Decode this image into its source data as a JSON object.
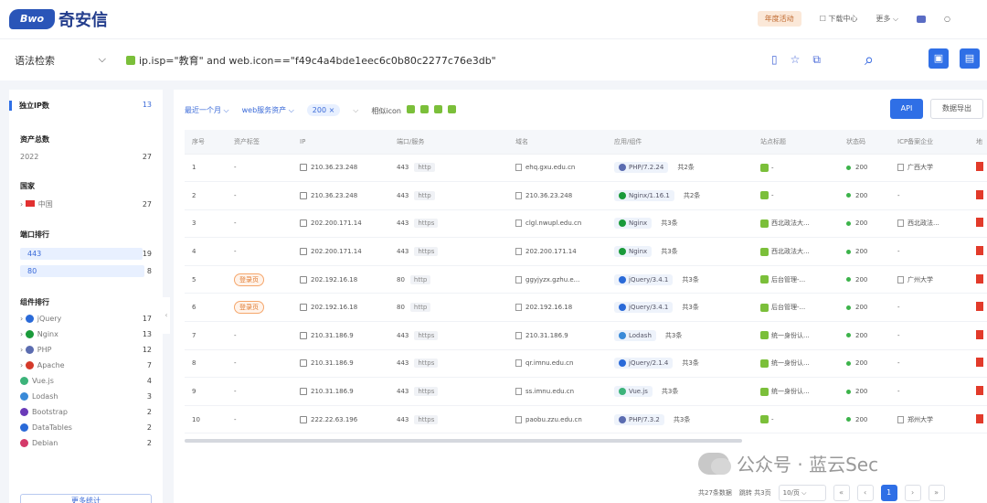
{
  "header": {
    "logo_mark": "Bwo",
    "logo_text": "奇安信",
    "promo": "年度活动",
    "download": "下载中心",
    "more": "更多"
  },
  "search": {
    "type": "语法检索",
    "query": "ip.isp=\"教育\" and web.icon==\"f49c4a4bde1eec6c0b80c2277c76e3db\""
  },
  "sidebar": {
    "unique_ip": {
      "label": "独立IP数",
      "count": "13"
    },
    "asset_total": {
      "label": "资产总数",
      "year": "2022",
      "count": "27"
    },
    "country": {
      "label": "国家",
      "name": "中国",
      "count": "27"
    },
    "ports": {
      "label": "端口排行",
      "items": [
        {
          "port": "443",
          "count": "19"
        },
        {
          "port": "80",
          "count": "8"
        }
      ]
    },
    "components": {
      "label": "组件排行",
      "items": [
        {
          "name": "jQuery",
          "count": "17",
          "color": "#2a6ad8"
        },
        {
          "name": "Nginx",
          "count": "13",
          "color": "#1a9a3a"
        },
        {
          "name": "PHP",
          "count": "12",
          "color": "#5b6cb0"
        },
        {
          "name": "Apache",
          "count": "7",
          "color": "#d43a2a"
        },
        {
          "name": "Vue.js",
          "count": "4",
          "color": "#3cb37a"
        },
        {
          "name": "Lodash",
          "count": "3",
          "color": "#3a8ad8"
        },
        {
          "name": "Bootstrap",
          "count": "2",
          "color": "#6a3ab8"
        },
        {
          "name": "DataTables",
          "count": "2",
          "color": "#2a6ad8"
        },
        {
          "name": "Debian",
          "count": "2",
          "color": "#d43a6a"
        }
      ]
    },
    "footer": "更多统计"
  },
  "filters": {
    "time": "最近一个月",
    "asset": "web服务资产",
    "status": "200",
    "icon_label": "相似icon"
  },
  "buttons": {
    "api": "API",
    "export": "数据导出"
  },
  "table": {
    "headers": [
      "序号",
      "资产标签",
      "IP",
      "端口/服务",
      "域名",
      "应用/组件",
      "站点标题",
      "状态码",
      "ICP备案企业",
      "地"
    ],
    "rows": [
      {
        "no": "1",
        "tag": "-",
        "ip": "210.36.23.248",
        "port": "443",
        "proto": "http",
        "domain": "ehq.gxu.edu.cn",
        "app": "PHP/7.2.24",
        "app_color": "#5b6cb0",
        "app_cnt": "共2条",
        "title": "-",
        "status": "200",
        "icp": "广西大学"
      },
      {
        "no": "2",
        "tag": "-",
        "ip": "210.36.23.248",
        "port": "443",
        "proto": "http",
        "domain": "210.36.23.248",
        "app": "Nginx/1.16.1",
        "app_color": "#1a9a3a",
        "app_cnt": "共2条",
        "title": "-",
        "status": "200",
        "icp": "-"
      },
      {
        "no": "3",
        "tag": "-",
        "ip": "202.200.171.14",
        "port": "443",
        "proto": "https",
        "domain": "clgl.nwupl.edu.cn",
        "app": "Nginx",
        "app_color": "#1a9a3a",
        "app_cnt": "共3条",
        "title": "西北政法大...",
        "status": "200",
        "icp": "西北政法..."
      },
      {
        "no": "4",
        "tag": "-",
        "ip": "202.200.171.14",
        "port": "443",
        "proto": "https",
        "domain": "202.200.171.14",
        "app": "Nginx",
        "app_color": "#1a9a3a",
        "app_cnt": "共3条",
        "title": "西北政法大...",
        "status": "200",
        "icp": "-"
      },
      {
        "no": "5",
        "tag": "登录页",
        "ip": "202.192.16.18",
        "port": "80",
        "proto": "http",
        "domain": "ggyjyzx.gzhu.e...",
        "app": "jQuery/3.4.1",
        "app_color": "#2a6ad8",
        "app_cnt": "共3条",
        "title": "后台管理-...",
        "status": "200",
        "icp": "广州大学"
      },
      {
        "no": "6",
        "tag": "登录页",
        "ip": "202.192.16.18",
        "port": "80",
        "proto": "http",
        "domain": "202.192.16.18",
        "app": "jQuery/3.4.1",
        "app_color": "#2a6ad8",
        "app_cnt": "共3条",
        "title": "后台管理-...",
        "status": "200",
        "icp": "-"
      },
      {
        "no": "7",
        "tag": "-",
        "ip": "210.31.186.9",
        "port": "443",
        "proto": "https",
        "domain": "210.31.186.9",
        "app": "Lodash",
        "app_color": "#3a8ad8",
        "app_cnt": "共3条",
        "title": "统一身份认...",
        "status": "200",
        "icp": "-"
      },
      {
        "no": "8",
        "tag": "-",
        "ip": "210.31.186.9",
        "port": "443",
        "proto": "https",
        "domain": "qr.imnu.edu.cn",
        "app": "jQuery/2.1.4",
        "app_color": "#2a6ad8",
        "app_cnt": "共3条",
        "title": "统一身份认...",
        "status": "200",
        "icp": "-"
      },
      {
        "no": "9",
        "tag": "-",
        "ip": "210.31.186.9",
        "port": "443",
        "proto": "https",
        "domain": "ss.imnu.edu.cn",
        "app": "Vue.js",
        "app_color": "#3cb37a",
        "app_cnt": "共3条",
        "title": "统一身份认...",
        "status": "200",
        "icp": "-"
      },
      {
        "no": "10",
        "tag": "-",
        "ip": "222.22.63.196",
        "port": "443",
        "proto": "https",
        "domain": "paobu.zzu.edu.cn",
        "app": "PHP/7.3.2",
        "app_color": "#5b6cb0",
        "app_cnt": "共3条",
        "title": "-",
        "status": "200",
        "icp": "郑州大学"
      }
    ]
  },
  "pager": {
    "total": "共27条数据",
    "jump": "跳转 共3页",
    "size": "10/页",
    "current": "1"
  },
  "watermark": "公众号 · 蓝云Sec"
}
